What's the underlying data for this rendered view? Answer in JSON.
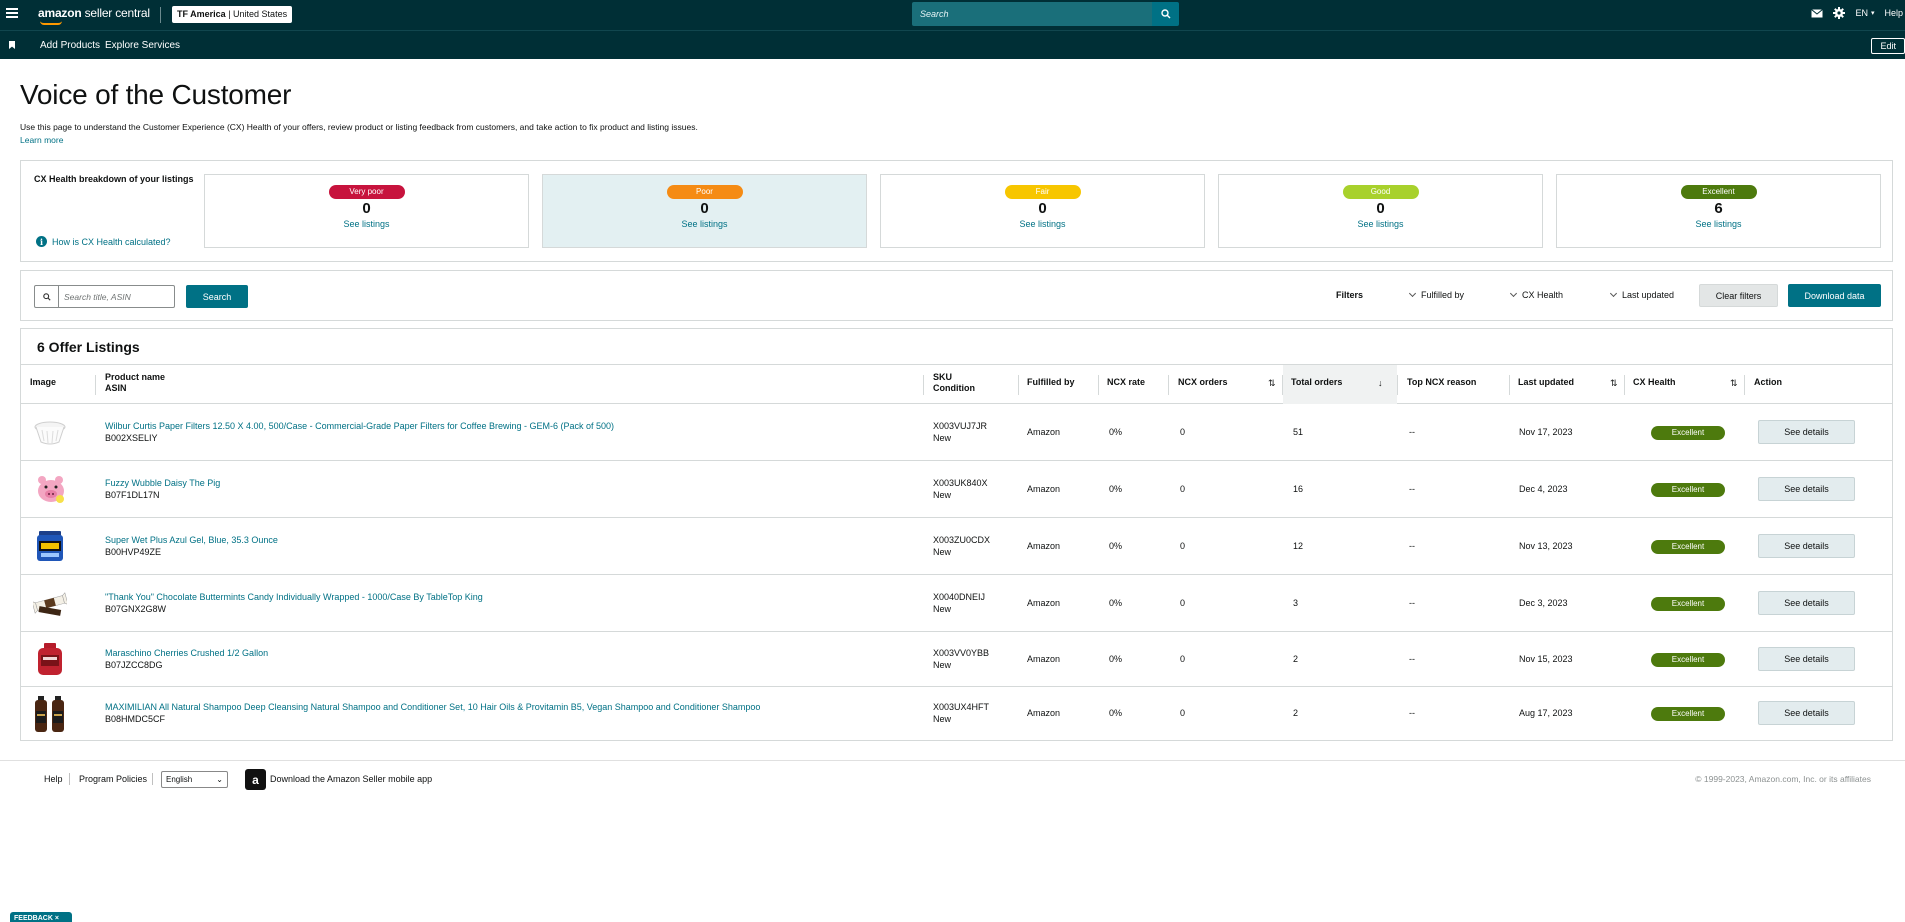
{
  "topnav": {
    "logo_brand": "amazon",
    "logo_text": "seller central",
    "account_bold": "TF America",
    "account_region": "| United States",
    "search_placeholder": "Search",
    "language": "EN",
    "help": "Help",
    "icons": [
      "menu-icon",
      "search-icon",
      "mail-icon",
      "gear-icon",
      "chevron-down-icon"
    ]
  },
  "subnav": {
    "items": [
      "Add Products",
      "Explore Services"
    ],
    "edit_label": "Edit"
  },
  "page": {
    "title": "Voice of the Customer",
    "description": "Use this page to understand the Customer Experience (CX) Health of your offers, review product or listing feedback from customers, and take action to fix product and listing issues.",
    "learn_more": "Learn more"
  },
  "cx_health": {
    "label": "CX Health breakdown of your listings",
    "how_link": "How is CX Health calculated?",
    "cards": [
      {
        "label": "Very poor",
        "count": "0",
        "link": "See listings",
        "color": "#c7133d"
      },
      {
        "label": "Poor",
        "count": "0",
        "link": "See listings",
        "color": "#f58b14"
      },
      {
        "label": "Fair",
        "count": "0",
        "link": "See listings",
        "color": "#f7c600"
      },
      {
        "label": "Good",
        "count": "0",
        "link": "See listings",
        "color": "#a8d12c"
      },
      {
        "label": "Excellent",
        "count": "6",
        "link": "See listings",
        "color": "#4d7a0d"
      }
    ]
  },
  "toolbar": {
    "search_placeholder": "Search title, ASIN",
    "search_button": "Search",
    "filters_label": "Filters",
    "filter_fulfilled": "Fulfilled by",
    "filter_cx": "CX Health",
    "filter_updated": "Last updated",
    "clear_filters": "Clear filters",
    "download": "Download data"
  },
  "table": {
    "title": "6 Offer Listings",
    "headers": {
      "image": "Image",
      "product_name": "Product name",
      "asin": "ASIN",
      "sku": "SKU",
      "condition": "Condition",
      "fulfilled_by": "Fulfilled by",
      "ncx_rate": "NCX rate",
      "ncx_orders": "NCX orders",
      "total_orders": "Total orders",
      "top_ncx_reason": "Top NCX reason",
      "last_updated": "Last updated",
      "cx_health": "CX Health",
      "action": "Action"
    },
    "rows": [
      {
        "name": "Wilbur Curtis Paper Filters 12.50 X 4.00, 500/Case - Commercial-Grade Paper Filters for Coffee Brewing - GEM-6 (Pack of 500)",
        "asin": "B002XSELIY",
        "sku": "X003VUJ7JR",
        "condition": "New",
        "fulfilled": "Amazon",
        "ncx_rate": "0%",
        "ncx_orders": "0",
        "total_orders": "51",
        "reason": "--",
        "updated": "Nov 17, 2023",
        "health": "Excellent",
        "action": "See details"
      },
      {
        "name": "Fuzzy Wubble Daisy The Pig",
        "asin": "B07F1DL17N",
        "sku": "X003UK840X",
        "condition": "New",
        "fulfilled": "Amazon",
        "ncx_rate": "0%",
        "ncx_orders": "0",
        "total_orders": "16",
        "reason": "--",
        "updated": "Dec 4, 2023",
        "health": "Excellent",
        "action": "See details"
      },
      {
        "name": "Super Wet Plus Azul Gel, Blue, 35.3 Ounce",
        "asin": "B00HVP49ZE",
        "sku": "X003ZU0CDX",
        "condition": "New",
        "fulfilled": "Amazon",
        "ncx_rate": "0%",
        "ncx_orders": "0",
        "total_orders": "12",
        "reason": "--",
        "updated": "Nov 13, 2023",
        "health": "Excellent",
        "action": "See details"
      },
      {
        "name": "\"Thank You\" Chocolate Buttermints Candy Individually Wrapped - 1000/Case By TableTop King",
        "asin": "B07GNX2G8W",
        "sku": "X0040DNEIJ",
        "condition": "New",
        "fulfilled": "Amazon",
        "ncx_rate": "0%",
        "ncx_orders": "0",
        "total_orders": "3",
        "reason": "--",
        "updated": "Dec 3, 2023",
        "health": "Excellent",
        "action": "See details"
      },
      {
        "name": "Maraschino Cherries Crushed 1/2 Gallon",
        "asin": "B07JZCC8DG",
        "sku": "X003VV0YBB",
        "condition": "New",
        "fulfilled": "Amazon",
        "ncx_rate": "0%",
        "ncx_orders": "0",
        "total_orders": "2",
        "reason": "--",
        "updated": "Nov 15, 2023",
        "health": "Excellent",
        "action": "See details"
      },
      {
        "name": "MAXIMILIAN All Natural Shampoo Deep Cleansing Natural Shampoo and Conditioner Set, 10 Hair Oils & Provitamin B5, Vegan Shampoo and Conditioner Shampoo",
        "asin": "B08HMDC5CF",
        "sku": "X003UX4HFT",
        "condition": "New",
        "fulfilled": "Amazon",
        "ncx_rate": "0%",
        "ncx_orders": "0",
        "total_orders": "2",
        "reason": "--",
        "updated": "Aug 17, 2023",
        "health": "Excellent",
        "action": "See details"
      }
    ]
  },
  "footer": {
    "help": "Help",
    "policies": "Program Policies",
    "language": "English",
    "app_link": "Download the Amazon Seller mobile app",
    "copyright": "© 1999-2023, Amazon.com, Inc. or its affiliates"
  },
  "feedback": "FEEDBACK"
}
